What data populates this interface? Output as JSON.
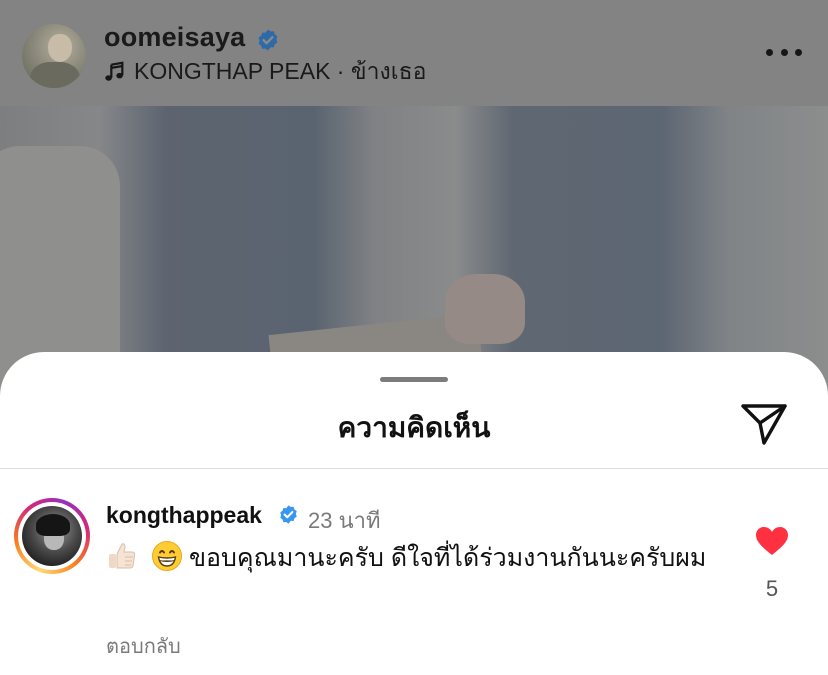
{
  "post_header": {
    "username": "oomeisaya",
    "music": "KONGTHAP PEAK · ข้างเธอ",
    "icons": {
      "verified": "verified-badge-icon",
      "music": "music-note-icon",
      "more": "more-horizontal-icon"
    }
  },
  "comments_sheet": {
    "title": "ความคิดเห็น",
    "share_icon": "send-paper-plane-icon"
  },
  "comment": {
    "username": "kongthappeak",
    "time": "23 นาที",
    "emojis": [
      "thumbs-up-emoji",
      "grinning-face-emoji"
    ],
    "text": "ขอบคุณมานะครับ ดีใจที่ได้ร่วมงานกันนะครับผม",
    "reply_label": "ตอบกลับ",
    "like_count": "5",
    "liked": true
  },
  "colors": {
    "verified_blue": "#3797f0",
    "like_red": "#ff3040",
    "dimmed_overlay": "#838383"
  }
}
